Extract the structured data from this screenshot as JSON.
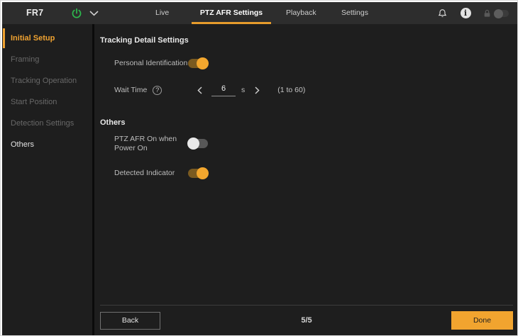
{
  "window": {
    "brand": "FR7"
  },
  "header": {
    "tabs": [
      {
        "label": "Live",
        "active": false
      },
      {
        "label": "PTZ AFR Settings",
        "active": true
      },
      {
        "label": "Playback",
        "active": false
      },
      {
        "label": "Settings",
        "active": false
      }
    ],
    "icons": {
      "power": "power-icon",
      "chevron": "chevron-down-icon",
      "bell": "bell-icon",
      "info_glyph": "i",
      "lock": "lock-icon",
      "lock_toggle_state": "off"
    }
  },
  "sidebar": {
    "items": [
      {
        "label": "Initial Setup",
        "state": "active"
      },
      {
        "label": "Framing",
        "state": "disabled"
      },
      {
        "label": "Tracking Operation",
        "state": "disabled"
      },
      {
        "label": "Start Position",
        "state": "disabled"
      },
      {
        "label": "Detection Settings",
        "state": "disabled"
      },
      {
        "label": "Others",
        "state": "normal"
      }
    ]
  },
  "content": {
    "section1": {
      "title": "Tracking Detail Settings",
      "personal_identification": {
        "label": "Personal Identification",
        "state": "on"
      },
      "wait_time": {
        "label": "Wait Time",
        "help_glyph": "?",
        "value": "6",
        "unit": "s",
        "range": "(1 to 60)"
      }
    },
    "section2": {
      "title": "Others",
      "ptz_afr_power": {
        "label": "PTZ AFR On when Power On",
        "state": "off"
      },
      "detected_indicator": {
        "label": "Detected Indicator",
        "state": "on"
      }
    }
  },
  "footer": {
    "back": "Back",
    "page": "5/5",
    "done": "Done"
  },
  "colors": {
    "accent": "#f1a42f",
    "power_green": "#2db84d",
    "header_bg": "#2d2d2d",
    "app_bg": "#1e1e1e"
  }
}
